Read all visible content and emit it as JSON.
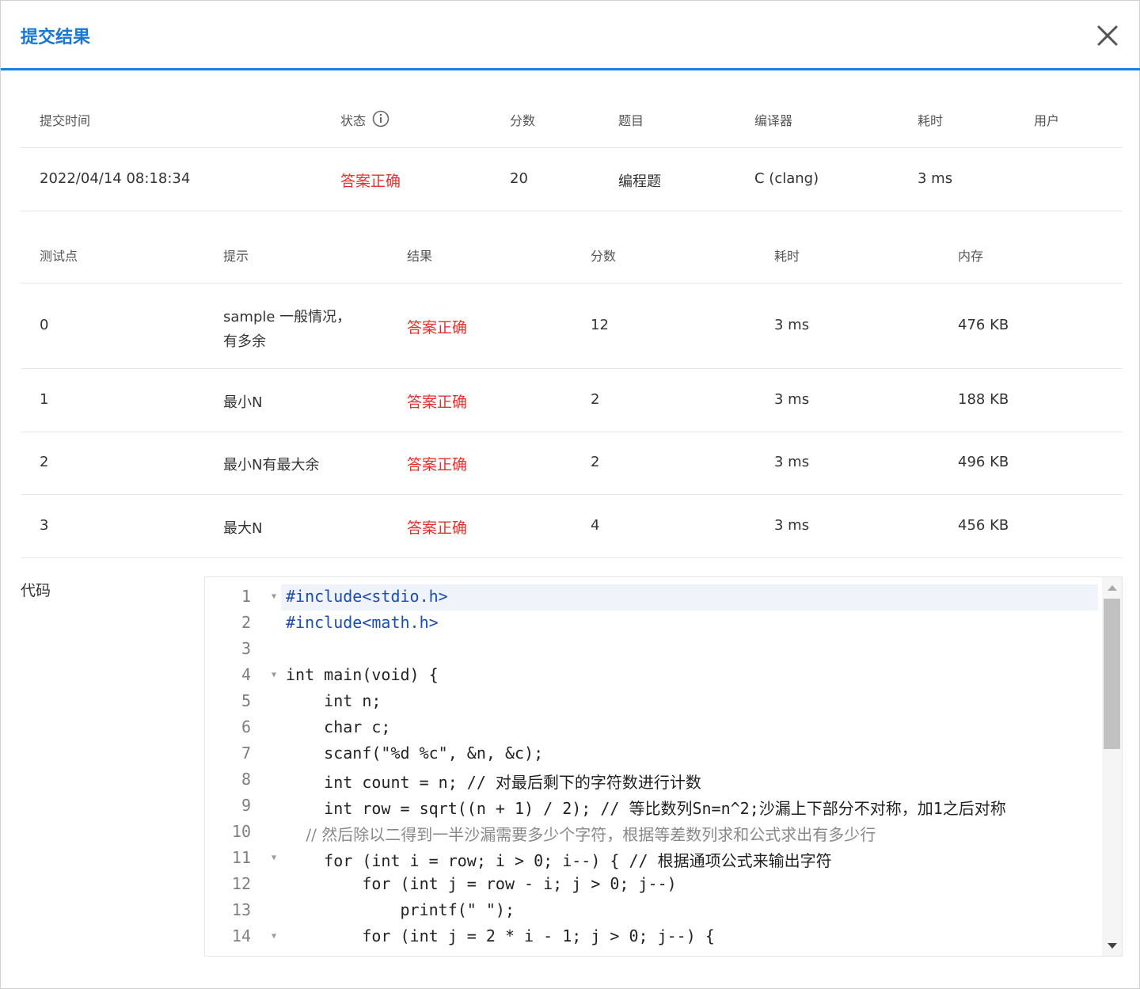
{
  "dialog": {
    "title": "提交结果",
    "close_icon": "close-icon"
  },
  "summary": {
    "headers": [
      "提交时间",
      "状态",
      "分数",
      "题目",
      "编译器",
      "耗时",
      "用户"
    ],
    "row": [
      "2022/04/14 08:18:34",
      "答案正确",
      "20",
      "编程题",
      "C (clang)",
      "3 ms",
      ""
    ]
  },
  "testcases": {
    "headers": [
      "测试点",
      "提示",
      "结果",
      "分数",
      "耗时",
      "内存"
    ],
    "rows": [
      [
        "0",
        "sample 一般情况，",
        "有多余",
        "答案正确",
        "12",
        "3 ms",
        "476 KB"
      ],
      [
        "1",
        "最小N",
        "",
        "答案正确",
        "2",
        "3 ms",
        "188 KB"
      ],
      [
        "2",
        "最小N有最大余",
        "",
        "答案正确",
        "2",
        "3 ms",
        "496 KB"
      ],
      [
        "3",
        "最大N",
        "",
        "答案正确",
        "4",
        "3 ms",
        "456 KB"
      ]
    ]
  },
  "code": {
    "label": "代码",
    "line_numbers": [
      "1",
      "2",
      "3",
      "4",
      "5",
      "6",
      "7",
      "8",
      "9",
      "10",
      "11",
      "12",
      "13",
      "14"
    ],
    "lines": [
      "#include<stdio.h>",
      "#include<math.h>",
      "",
      "int main(void) {",
      "    int n;",
      "    char c;",
      "    scanf(\"%d %c\", &n, &c);",
      "    int count = n; // 对最后剩下的字符数进行计数",
      "    int row = sqrt((n + 1) / 2); // 等比数列Sn=n^2;沙漏上下部分不对称，加1之后对称",
      "    // 然后除以二得到一半沙漏需要多少个字符，根据等差数列求和公式求出有多少行",
      "    for (int i = row; i > 0; i--) { // 根据通项公式来输出字符",
      "        for (int j = row - i; j > 0; j--)",
      "            printf(\" \");",
      "        for (int j = 2 * i - 1; j > 0; j--) {"
    ]
  },
  "colors": {
    "accent": "#1677d6",
    "success_text": "#e8312c",
    "header_border": "#1a80e6"
  }
}
